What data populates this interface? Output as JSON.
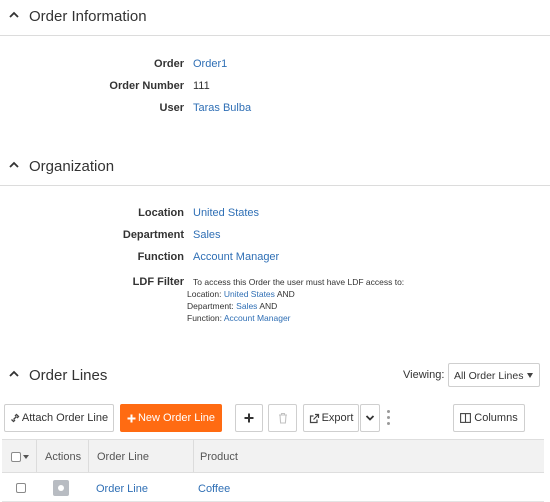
{
  "order_information": {
    "title": "Order Information",
    "fields": [
      {
        "label": "Order",
        "value": "Order1"
      },
      {
        "label": "Order Number",
        "value": "111"
      },
      {
        "label": "User",
        "value": "Taras Bulba"
      }
    ]
  },
  "organization": {
    "title": "Organization",
    "fields": [
      {
        "label": "Location",
        "value": "United States"
      },
      {
        "label": "Department",
        "value": "Sales"
      },
      {
        "label": "Function",
        "value": "Account Manager"
      }
    ],
    "ldf": {
      "label": "LDF Filter",
      "intro": "To access this Order the user must have LDF access to:",
      "location_label": "Location:",
      "location_value": "United States",
      "department_label": "Department:",
      "department_value": "Sales",
      "function_label": "Function:",
      "function_value": "Account Manager",
      "and_word": "AND"
    }
  },
  "order_lines": {
    "title": "Order Lines",
    "viewing_label": "Viewing:",
    "viewing_value": "All Order Lines",
    "toolbar": {
      "attach_label": "Attach Order Line",
      "new_label": "New Order Line",
      "export_label": "Export",
      "columns_label": "Columns"
    },
    "columns": [
      "Actions",
      "Order Line",
      "Product"
    ],
    "rows": [
      {
        "order_line": "Order Line",
        "product": "Coffee"
      }
    ]
  },
  "colors": {
    "accent": "#ff6b12",
    "link": "#2f6fb5"
  },
  "icons": [
    "chevron-up-icon",
    "link-icon",
    "plus-icon",
    "trash-icon",
    "export-icon",
    "chevron-down-icon",
    "kebab-icon",
    "columns-icon",
    "gear-icon"
  ]
}
